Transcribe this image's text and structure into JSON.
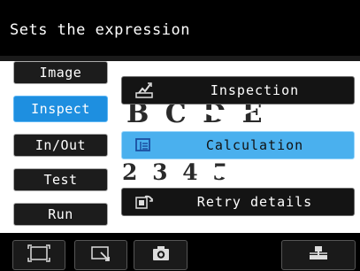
{
  "title": "Sets the expression",
  "background": {
    "text_line_1": "B C D E",
    "text_line_2": "2 3 4 5"
  },
  "nav": {
    "items": [
      {
        "label": "Image",
        "active": false
      },
      {
        "label": "Inspect",
        "active": true
      },
      {
        "label": "In/Out",
        "active": false
      },
      {
        "label": "Test",
        "active": false
      },
      {
        "label": "Run",
        "active": false
      }
    ]
  },
  "submenu": {
    "items": [
      {
        "label": "Inspection",
        "icon": "inspection-icon",
        "active": false
      },
      {
        "label": "Calculation",
        "icon": "calculation-icon",
        "active": true
      },
      {
        "label": "Retry details",
        "icon": "retry-details-icon",
        "active": false
      }
    ]
  },
  "toolbar": {
    "buttons": [
      {
        "icon": "fit-screen-icon"
      },
      {
        "icon": "zoom-window-icon"
      },
      {
        "icon": "camera-icon"
      },
      {
        "icon": "network-icon"
      }
    ]
  },
  "colors": {
    "active_nav": "#1e8fe0",
    "active_menu": "#4ab0ee"
  }
}
